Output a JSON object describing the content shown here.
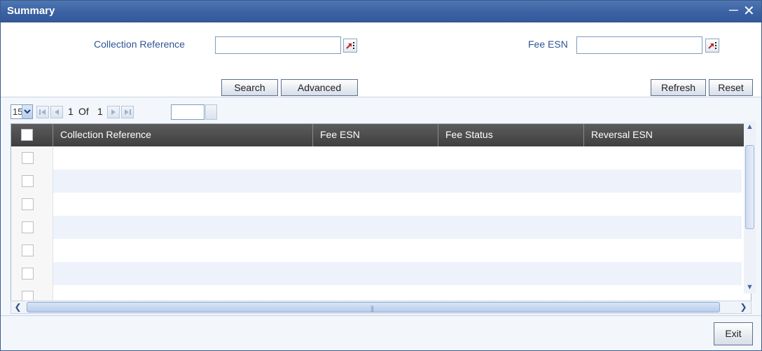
{
  "window": {
    "title": "Summary"
  },
  "search": {
    "collection_reference_label": "Collection Reference",
    "collection_reference_value": "",
    "fee_esn_label": "Fee ESN",
    "fee_esn_value": "",
    "search_label": "Search",
    "advanced_label": "Advanced",
    "refresh_label": "Refresh",
    "reset_label": "Reset"
  },
  "pager": {
    "page_size": "15",
    "current_page": "1",
    "of_label": "Of",
    "total_pages": "1",
    "goto_value": ""
  },
  "grid": {
    "columns": [
      "Collection Reference",
      "Fee ESN",
      "Fee Status",
      "Reversal ESN"
    ],
    "rows": [
      [
        "",
        "",
        "",
        ""
      ],
      [
        "",
        "",
        "",
        ""
      ],
      [
        "",
        "",
        "",
        ""
      ],
      [
        "",
        "",
        "",
        ""
      ],
      [
        "",
        "",
        "",
        ""
      ],
      [
        "",
        "",
        "",
        ""
      ],
      [
        "",
        "",
        "",
        ""
      ]
    ]
  },
  "footer": {
    "exit_label": "Exit"
  },
  "icons": {
    "minimize": "minimize-icon",
    "close": "close-icon",
    "lov": "list-of-values-icon",
    "select_arrow": "chevron-down-icon",
    "first": "first-page-icon",
    "prev": "previous-page-icon",
    "next": "next-page-icon",
    "last": "last-page-icon",
    "scroll_up": "scroll-up-icon",
    "scroll_down": "scroll-down-icon",
    "scroll_left": "scroll-left-icon",
    "scroll_right": "scroll-right-icon"
  },
  "colors": {
    "titlebar": "#3b62a3",
    "label": "#2f5596",
    "grid_header": "#4a4a4a",
    "alt_row": "#eef3fb"
  }
}
